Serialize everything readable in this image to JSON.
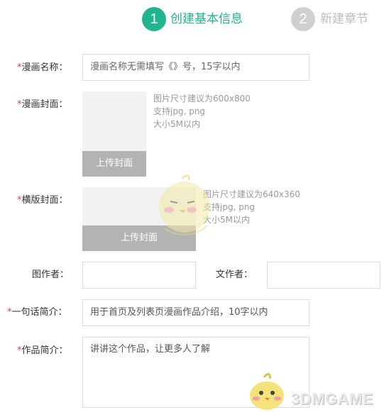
{
  "steps": [
    {
      "number": "1",
      "label": "创建基本信息",
      "state": "active"
    },
    {
      "number": "2",
      "label": "新建章节",
      "state": "inactive"
    }
  ],
  "colors": {
    "accent": "#22b38f",
    "required": "#e0413d",
    "inactive": "#d0d0d0"
  },
  "form": {
    "required_mark": "*",
    "title": {
      "label": "漫画名称：",
      "placeholder": "漫画名称无需填写《》号，15字以内"
    },
    "cover": {
      "label": "漫画封面：",
      "hints": [
        "图片尺寸建议为600x800",
        "支持jpg, png",
        "大小5M以内"
      ],
      "button": "上传封面"
    },
    "banner": {
      "label": "横版封面：",
      "hints": [
        "图片尺寸建议为640x360",
        "支持jpg, png",
        "大小5M以内"
      ],
      "button": "上传封面"
    },
    "artist": {
      "label": "图作者：",
      "value": ""
    },
    "writer": {
      "label": "文作者：",
      "value": ""
    },
    "tagline": {
      "label": "一句话简介：",
      "placeholder": "用于首页及列表页漫画作品介绍，10字以内"
    },
    "synopsis": {
      "label": "作品简介：",
      "placeholder": "讲讲这个作品，让更多人了解"
    }
  },
  "watermark": {
    "text": "3DMGAME"
  }
}
